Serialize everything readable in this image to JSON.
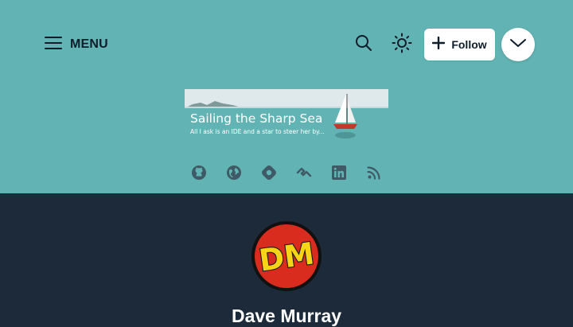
{
  "header": {
    "menu_label": "MENU",
    "menu_icon": "hamburger-icon",
    "search_icon": "search-icon",
    "theme_icon": "sun-icon",
    "follow_label": "Follow",
    "follow_icon": "plus-icon",
    "expand_icon": "chevron-down-icon"
  },
  "banner": {
    "title": "Sailing the Sharp Sea",
    "tagline": "All I ask is an IDE and a star to steer her by..."
  },
  "socials": [
    {
      "icon": "github-icon"
    },
    {
      "icon": "globe-icon"
    },
    {
      "icon": "hashnode-icon"
    },
    {
      "icon": "devto-icon"
    },
    {
      "icon": "linkedin-icon"
    },
    {
      "icon": "rss-icon"
    }
  ],
  "profile": {
    "avatar_text": "DM",
    "author_name": "Dave Murray"
  },
  "colors": {
    "header_bg": "#62b3b3",
    "body_bg": "#1c2a3a",
    "icon_dark": "#0f1d2b",
    "social_icon": "#3f5a66"
  }
}
